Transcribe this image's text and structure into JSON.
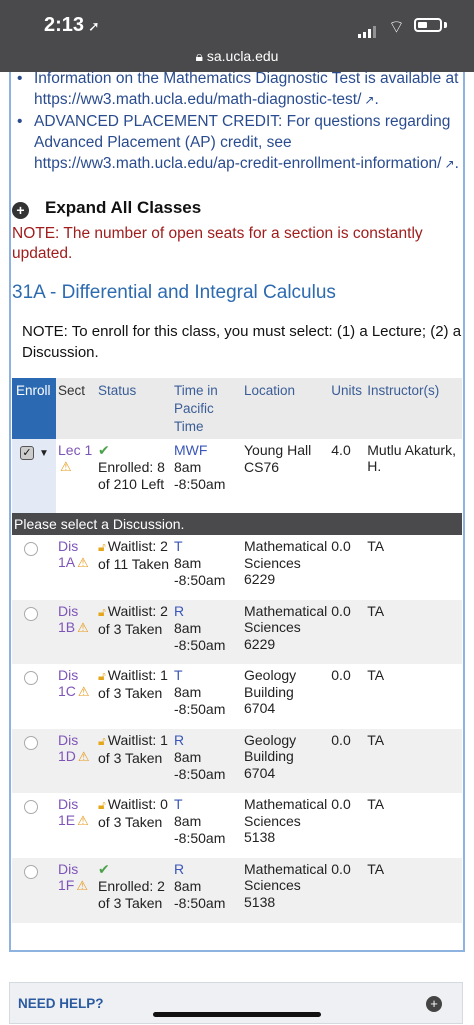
{
  "status_bar": {
    "time": "2:13",
    "url": "sa.ucla.edu"
  },
  "info_bullets": [
    {
      "text": "Information on the Mathematics Diagnostic Test is available at",
      "link": "https://ww3.math.ucla.edu/math-diagnostic-test/",
      "suffix": "."
    },
    {
      "text": "ADVANCED PLACEMENT CREDIT: For questions regarding Advanced Placement (AP) credit, see",
      "link": "https://ww3.math.ucla.edu/ap-credit-enrollment-information/",
      "suffix": "."
    }
  ],
  "expand_label": "Expand All Classes",
  "seats_note": "NOTE: The number of open seats for a section is constantly updated.",
  "course_title": "31A - Differential and Integral Calculus",
  "enroll_note": "NOTE: To enroll for this class, you must select: (1) a Lecture; (2) a Discussion.",
  "table": {
    "headers": {
      "enroll": "Enroll",
      "sect": "Sect",
      "status": "Status",
      "time": "Time in Pacific Time",
      "location": "Location",
      "units": "Units",
      "instructor": "Instructor(s)"
    },
    "lecture": {
      "sect": "Lec 1",
      "status": "Enrolled: 8 of 210 Left",
      "days": "MWF",
      "time": "8am -8:50am",
      "location": "Young Hall CS76",
      "units": "4.0",
      "instructor": "Mutlu Akaturk, H."
    },
    "discussion_prompt": "Please select a Discussion.",
    "discussions": [
      {
        "sect": "Dis 1A",
        "status": "Waitlist: 2 of 11 Taken",
        "days": "T",
        "time": "8am -8:50am",
        "location": "Mathematical Sciences 6229",
        "units": "0.0",
        "instructor": "TA"
      },
      {
        "sect": "Dis 1B",
        "status": "Waitlist: 2 of 3 Taken",
        "days": "R",
        "time": "8am -8:50am",
        "location": "Mathematical Sciences 6229",
        "units": "0.0",
        "instructor": "TA"
      },
      {
        "sect": "Dis 1C",
        "status": "Waitlist: 1 of 3 Taken",
        "days": "T",
        "time": "8am -8:50am",
        "location": "Geology Building 6704",
        "units": "0.0",
        "instructor": "TA"
      },
      {
        "sect": "Dis 1D",
        "status": "Waitlist: 1 of 3 Taken",
        "days": "R",
        "time": "8am -8:50am",
        "location": "Geology Building 6704",
        "units": "0.0",
        "instructor": "TA"
      },
      {
        "sect": "Dis 1E",
        "status": "Waitlist: 0 of 3 Taken",
        "days": "T",
        "time": "8am -8:50am",
        "location": "Mathematical Sciences 5138",
        "units": "0.0",
        "instructor": "TA"
      },
      {
        "sect": "Dis 1F",
        "status": "Enrolled: 2 of 3 Taken",
        "days": "R",
        "time": "8am -8:50am",
        "location": "Mathematical Sciences 5138",
        "units": "0.0",
        "instructor": "TA"
      }
    ]
  },
  "need_help": "NEED HELP?",
  "colors": {
    "enroll_header": "#2b6ab3",
    "title": "#2d6bb0",
    "note_red": "#a01d1d",
    "sect_link": "#7d55b8"
  }
}
